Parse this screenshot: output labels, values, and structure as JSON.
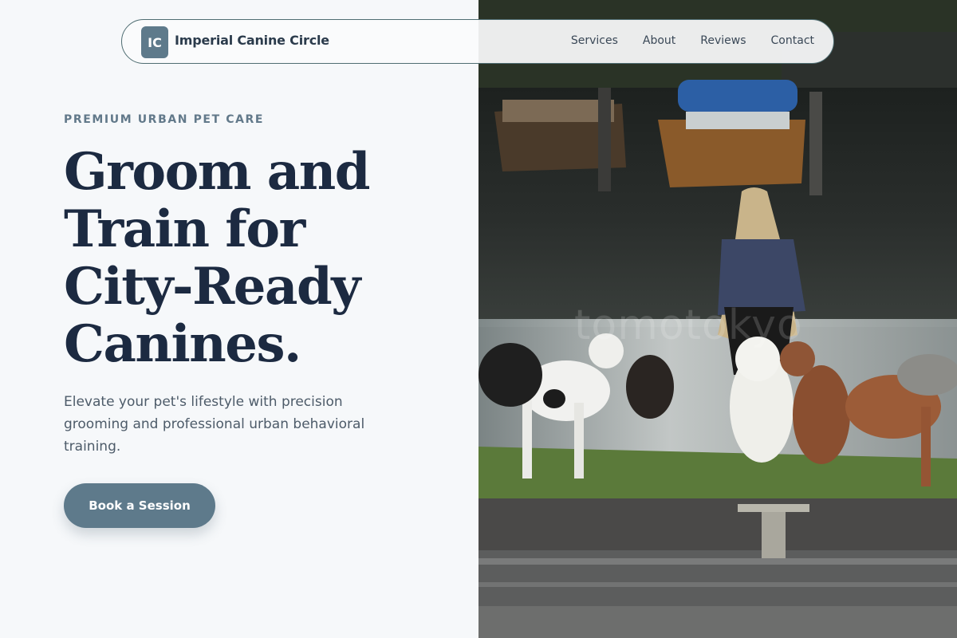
{
  "brand": {
    "mark": "IC",
    "name": "Imperial Canine Circle"
  },
  "nav": {
    "links": [
      "Services",
      "About",
      "Reviews",
      "Contact"
    ]
  },
  "hero": {
    "eyebrow": "PREMIUM URBAN PET CARE",
    "headline": "Groom and Train for City-Ready Canines.",
    "subtext": "Elevate your pet's lifestyle with precision grooming and professional urban behavioral training.",
    "cta_label": "Book a Session"
  },
  "photo": {
    "watermark": "tomotokyo"
  },
  "colors": {
    "accent": "#5e7a8b",
    "headline": "#1c2a41",
    "background": "#f6f8fa"
  }
}
